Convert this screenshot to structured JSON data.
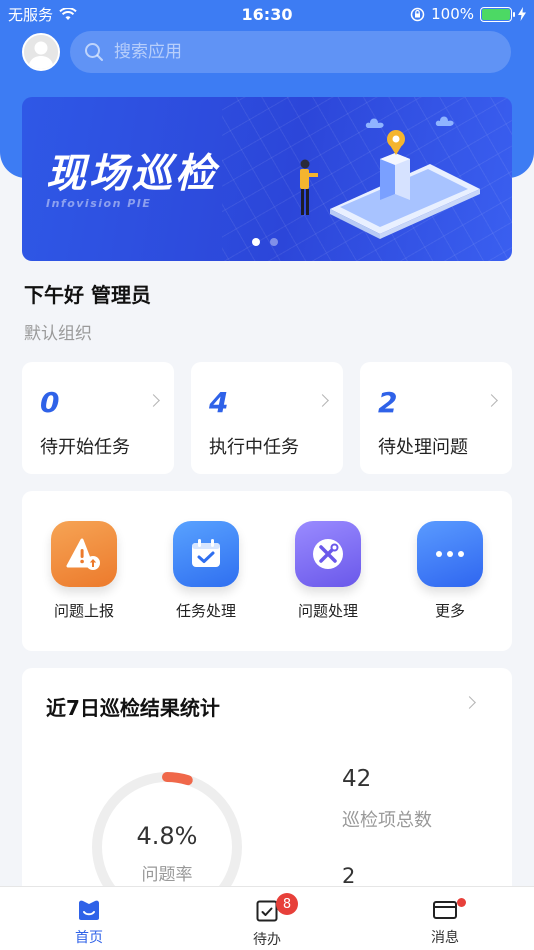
{
  "status_bar": {
    "carrier": "无服务",
    "time": "16:30",
    "battery": "100%"
  },
  "search": {
    "placeholder": "搜索应用"
  },
  "banner": {
    "title": "现场巡检",
    "subtitle": "Infovision PIE",
    "slides": 2,
    "active_slide": 1
  },
  "greeting": {
    "text": "下午好 管理员",
    "org": "默认组织"
  },
  "stats": [
    {
      "value": "0",
      "label": "待开始任务"
    },
    {
      "value": "4",
      "label": "执行中任务"
    },
    {
      "value": "2",
      "label": "待处理问题"
    }
  ],
  "apps": [
    {
      "name": "问题上报",
      "icon": "warning-upload-icon",
      "color": "#f28a3c"
    },
    {
      "name": "任务处理",
      "icon": "calendar-check-icon",
      "color": "#3f87f5"
    },
    {
      "name": "问题处理",
      "icon": "tools-icon",
      "color": "#7b6cf2"
    },
    {
      "name": "更多",
      "icon": "more-dots-icon",
      "color": "#3f7df6"
    }
  ],
  "inspection_stats": {
    "title": "近7日巡检结果统计",
    "problem_rate": "4.8%",
    "problem_rate_value": 0.048,
    "problem_rate_label": "问题率",
    "total_items": "42",
    "total_items_label": "巡检项总数",
    "second_value": "2"
  },
  "tabs": [
    {
      "label": "首页",
      "icon": "home-icon",
      "active": true
    },
    {
      "label": "待办",
      "icon": "todo-icon",
      "badge": "8"
    },
    {
      "label": "消息",
      "icon": "message-icon",
      "dot": true
    }
  ],
  "colors": {
    "primary": "#3d7cf3",
    "accent_ring": "#f0684a",
    "badge": "#e7403a"
  }
}
